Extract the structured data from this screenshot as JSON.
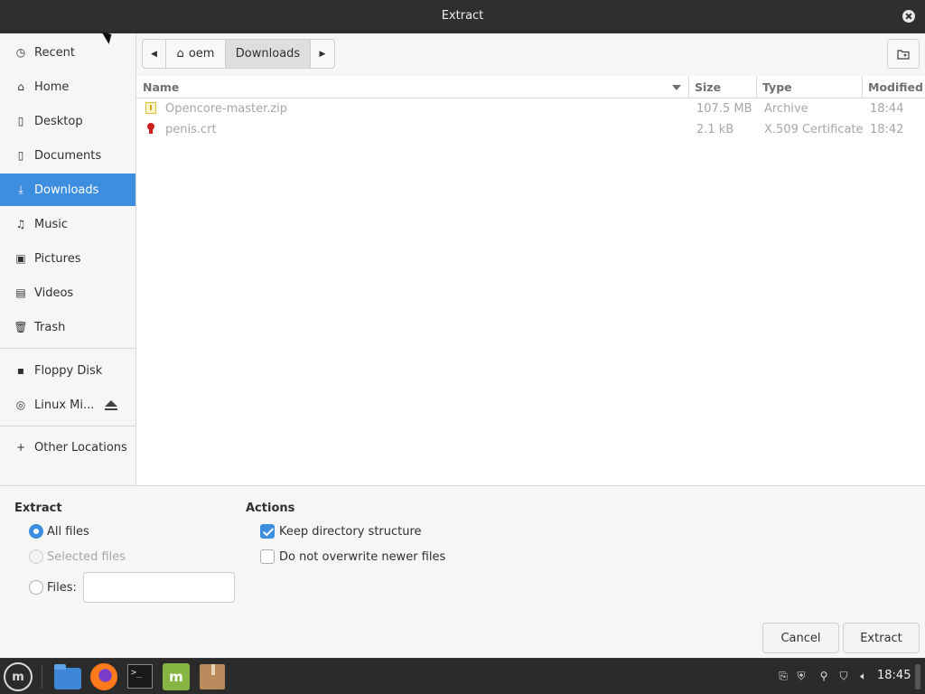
{
  "window": {
    "title": "Extract"
  },
  "sidebar": {
    "items": [
      {
        "label": "Recent",
        "icon": "clock-icon"
      },
      {
        "label": "Home",
        "icon": "home-icon"
      },
      {
        "label": "Desktop",
        "icon": "desktop-icon"
      },
      {
        "label": "Documents",
        "icon": "documents-icon"
      },
      {
        "label": "Downloads",
        "icon": "download-icon",
        "active": true
      },
      {
        "label": "Music",
        "icon": "music-icon"
      },
      {
        "label": "Pictures",
        "icon": "pictures-icon"
      },
      {
        "label": "Videos",
        "icon": "videos-icon"
      },
      {
        "label": "Trash",
        "icon": "trash-icon"
      }
    ],
    "devices": [
      {
        "label": "Floppy Disk",
        "icon": "floppy-icon"
      },
      {
        "label": "Linux Mi...",
        "icon": "disc-icon",
        "ejectable": true
      }
    ],
    "other": {
      "label": "Other Locations",
      "icon": "plus-icon"
    }
  },
  "pathbar": {
    "segments": [
      "oem",
      "Downloads"
    ],
    "current": "Downloads"
  },
  "filelist": {
    "columns": [
      "Name",
      "Size",
      "Type",
      "Modified"
    ],
    "sorted_by": "Name",
    "rows": [
      {
        "name": "Opencore-master.zip",
        "size": "107.5 MB",
        "type": "Archive",
        "modified": "18:44",
        "icon": "zip-file-icon"
      },
      {
        "name": "penis.crt",
        "size": "2.1 kB",
        "type": "X.509 Certificate",
        "modified": "18:42",
        "icon": "certificate-file-icon"
      }
    ]
  },
  "extract": {
    "title": "Extract",
    "all_files": "All files",
    "selected_files": "Selected files",
    "files_label": "Files:",
    "files_value": "",
    "selected": "all_files"
  },
  "actions": {
    "title": "Actions",
    "keep_structure": "Keep directory structure",
    "keep_structure_checked": true,
    "no_overwrite": "Do not overwrite newer files",
    "no_overwrite_checked": false
  },
  "buttons": {
    "cancel": "Cancel",
    "extract": "Extract"
  },
  "taskbar": {
    "clock": "18:45",
    "apps": [
      "menu-icon",
      "files-icon",
      "firefox-icon",
      "terminal-icon",
      "mint-update-icon",
      "archive-manager-icon"
    ]
  },
  "colors": {
    "accent": "#3e8ee0",
    "titlebar": "#2f2f2f",
    "taskbar": "#2b2b2b"
  }
}
